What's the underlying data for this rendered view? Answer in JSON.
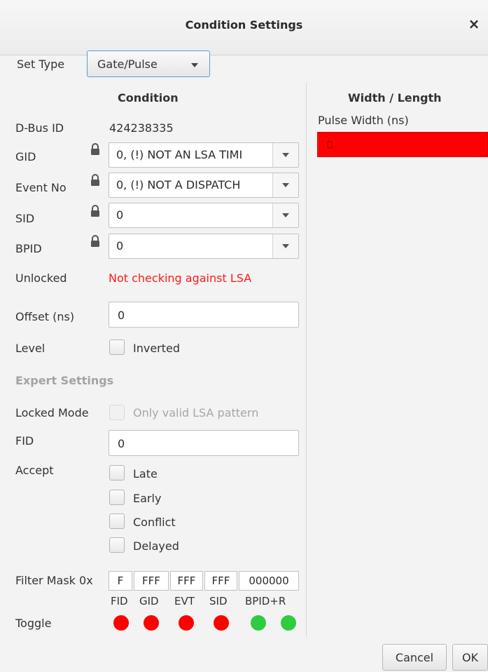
{
  "window": {
    "title": "Condition Settings",
    "close_glyph": "×"
  },
  "set_type": {
    "label": "Set Type",
    "value": "Gate/Pulse"
  },
  "condition": {
    "header": "Condition",
    "dbus_id": {
      "label": "D-Bus ID",
      "value": "424238335"
    },
    "gid": {
      "label": "GID",
      "value": "0, (!) NOT AN LSA TIMI"
    },
    "event_no": {
      "label": "Event No",
      "value": "0, (!) NOT A DISPATCH"
    },
    "sid": {
      "label": "SID",
      "value": "0"
    },
    "bpid": {
      "label": "BPID",
      "value": "0"
    },
    "unlocked": {
      "label": "Unlocked",
      "value": "Not checking against LSA",
      "color": "#ff1a1a"
    },
    "offset": {
      "label": "Offset (ns)",
      "value": "0"
    },
    "level": {
      "label": "Level",
      "checkbox_label": "Inverted"
    }
  },
  "expert": {
    "header": "Expert Settings",
    "locked_mode": {
      "label": "Locked Mode",
      "checkbox_label": "Only valid LSA pattern"
    },
    "fid": {
      "label": "FID",
      "value": "0"
    },
    "accept": {
      "label": "Accept",
      "options": [
        "Late",
        "Early",
        "Conflict",
        "Delayed"
      ]
    },
    "filter_mask": {
      "label": "Filter Mask 0x",
      "values": [
        "F",
        "FFF",
        "FFF",
        "FFF",
        "000000"
      ],
      "captions": [
        "FID",
        "GID",
        "EVT",
        "SID",
        "BPID+R"
      ]
    },
    "toggle": {
      "label": "Toggle",
      "states": [
        "red",
        "red",
        "red",
        "red",
        "green",
        "green"
      ],
      "colors": {
        "red": "#ff0000",
        "green": "#2ecc40"
      }
    }
  },
  "width_length": {
    "header": "Width / Length",
    "pulse_width": {
      "label": "Pulse Width (ns)",
      "value": "0",
      "bg_color": "#ff0000"
    }
  },
  "buttons": {
    "cancel": "Cancel",
    "ok": "OK"
  },
  "icons": {
    "lock": "padlock-icon",
    "dropdown": "chevron-down-icon"
  }
}
